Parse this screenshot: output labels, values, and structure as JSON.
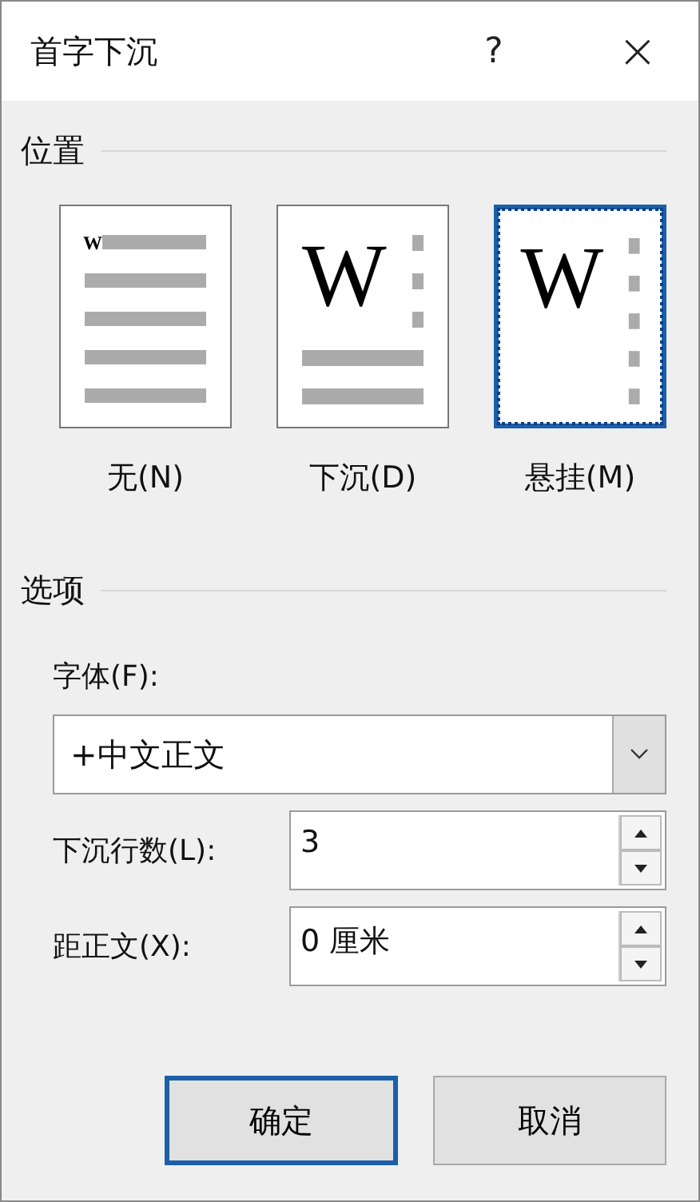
{
  "window": {
    "title": "首字下沉",
    "help": "?",
    "close": "×"
  },
  "position": {
    "heading": "位置",
    "options": [
      {
        "kind": "none",
        "glyph": "W",
        "label": "无(N)",
        "selected": false
      },
      {
        "kind": "dropped",
        "glyph": "W",
        "label": "下沉(D)",
        "selected": false
      },
      {
        "kind": "margin",
        "glyph": "W",
        "label": "悬挂(M)",
        "selected": true
      }
    ]
  },
  "options": {
    "heading": "选项",
    "font": {
      "label": "字体(F):",
      "value": "+中文正文"
    },
    "lines": {
      "label": "下沉行数(L):",
      "value": "3"
    },
    "distance": {
      "label": "距正文(X):",
      "value": "0 厘米"
    }
  },
  "buttons": [
    {
      "label": "确定",
      "default": true
    },
    {
      "label": "取消",
      "default": false
    }
  ]
}
